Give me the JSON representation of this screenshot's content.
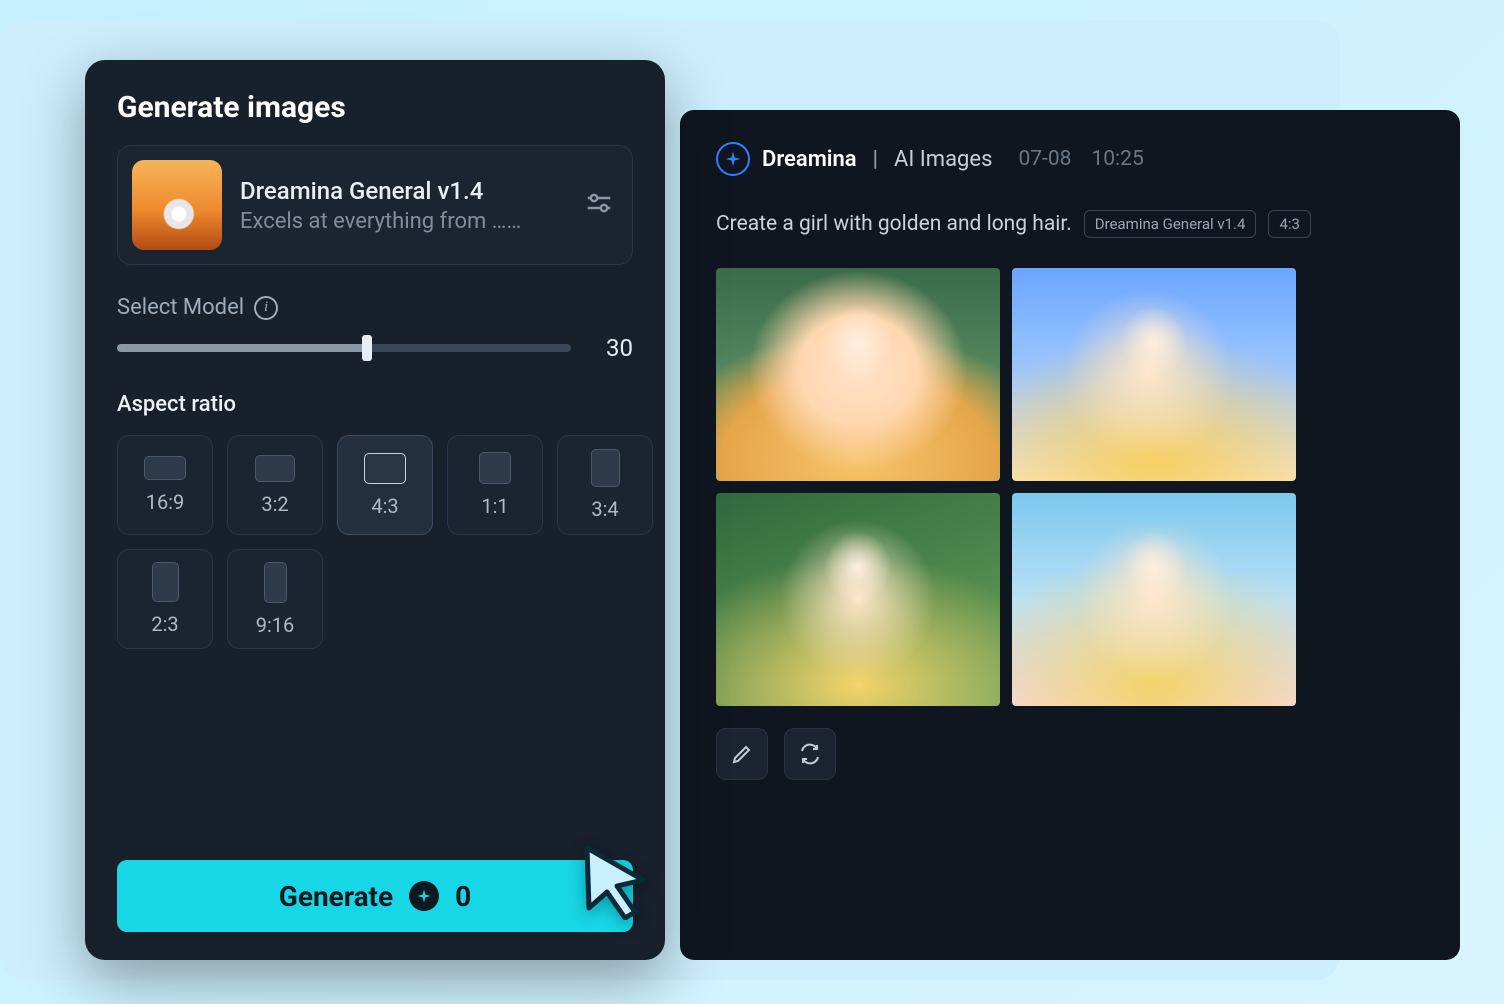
{
  "sidebar": {
    "title": "Generate images",
    "model": {
      "name": "Dreamina General v1.4",
      "description": "Excels at everything from ……"
    },
    "slider": {
      "label": "Select Model",
      "value": "30"
    },
    "aspect_ratio": {
      "label": "Aspect ratio",
      "options": [
        "16:9",
        "3:2",
        "4:3",
        "1:1",
        "3:4",
        "2:3",
        "9:16"
      ],
      "selected": "4:3"
    },
    "generate": {
      "label": "Generate",
      "credits": "0"
    }
  },
  "results": {
    "brand": "Dreamina",
    "section": "AI Images",
    "date": "07-08",
    "time": "10:25",
    "prompt": "Create a girl with golden and long hair.",
    "model_chip": "Dreamina General v1.4",
    "ratio_chip": "4:3"
  }
}
